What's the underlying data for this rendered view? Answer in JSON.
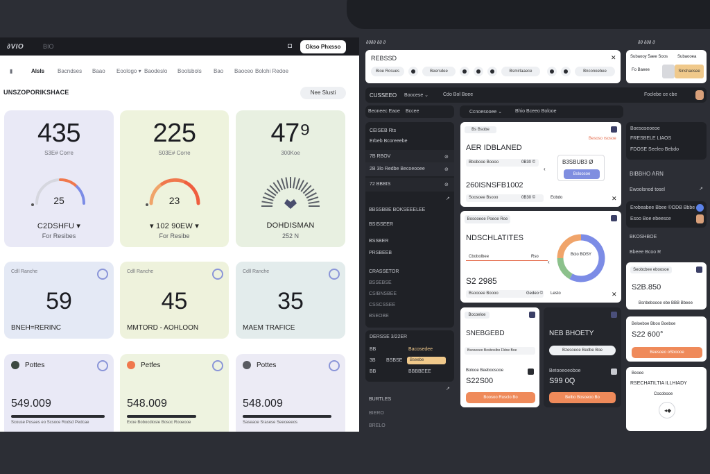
{
  "colors": {
    "accent_blue": "#7f8ee0",
    "accent_orange": "#ef8a5a",
    "gauge_red": "#f0784d",
    "gauge_blue": "#7c8ce6",
    "gauge_green": "#8cc18c",
    "dark_panel": "#1f2126",
    "backdrop": "#2c2e35"
  },
  "left": {
    "titlebar": {
      "brand": "∂VIO",
      "brand2": "BIO",
      "action_button": "Gkso Phxsso",
      "icon": "camera-icon"
    },
    "nav": [
      {
        "label": "Alsls",
        "active": true
      },
      {
        "label": "Bacndses"
      },
      {
        "label": "Baao"
      },
      {
        "label": "Eoologo ▾"
      },
      {
        "label": "Baodeslo"
      },
      {
        "label": "Boolsbols"
      },
      {
        "label": "Bao"
      },
      {
        "label": "Baoceo"
      },
      {
        "label": "Bolohi Redoe"
      }
    ],
    "section_title": "UNSZOPORIKSHACE",
    "section_button": "Nee Slusti",
    "stat_cards": [
      {
        "value": "435",
        "sub": "S3E# Corre",
        "gauge_value": "25",
        "foot1": "C2DSHFU ▾",
        "foot2": "For Resibes"
      },
      {
        "value": "225",
        "sub": "S03E# Corre",
        "gauge_value": "23",
        "foot1": "▾ 102 90EW ▾",
        "foot2": "For Resibe"
      },
      {
        "value": "47⁹",
        "sub": "300Koe",
        "gauge_value": "",
        "foot1": "DOHDISMAN",
        "foot2": "252 N"
      }
    ],
    "metric_cards": [
      {
        "label": "Cdll Ranche",
        "value": "59",
        "caption": "BNEH=RERINC"
      },
      {
        "label": "Cdll Ranche",
        "value": "45",
        "caption": "MMTORD - AOHLOON"
      },
      {
        "label": "Cdll Ranche",
        "value": "35",
        "caption": "MAEM TRAFICE"
      }
    ],
    "payment_cards": [
      {
        "label": "Pottes",
        "value": "549.009",
        "dot": "#3d4a42",
        "line": "#2a2c31",
        "foot": "Scouse Posaes eo Scsoce Rodsd Pedcae"
      },
      {
        "label": "Petfes",
        "value": "548.009",
        "dot": "#f0784d",
        "line": "#2a2c31",
        "foot": "Exoe Bobocdiosie Bosoc Rooeooe"
      },
      {
        "label": "Pottes",
        "value": "548.009",
        "dot": "#5a5c62",
        "line": "#2a2c31",
        "foot": "Saseaoe Srasese Seeceeeos"
      }
    ]
  },
  "right": {
    "header": {
      "brand": "∂∂∂∂ ∂∂ ∂",
      "right": "∂∂ ∂∂∂ ∂"
    },
    "filter_card": {
      "title": "REBSSD",
      "chips": [
        "Bioe Rosues",
        "Beersdee",
        "Bsmirlaaece",
        "Bnconoebee"
      ]
    },
    "mini_card": {
      "title": "Subaooy 5aee Soos",
      "title2": "Subaooea",
      "field": "Fo Baeee",
      "button": "Sinshaosee"
    },
    "search_bar": {
      "title": "CUSSEEO",
      "a": "Boocese ⌄",
      "b": "Cdo Bol Boee"
    },
    "sub_bar": {
      "a": "Beoneec Eaoe",
      "b": "Bccee",
      "c": "Ccnoesooee ⌄",
      "d": "Bhio Bceeo Bolooe"
    },
    "user": {
      "label": "Foclebe ce cbe"
    },
    "sidebar": {
      "group1": [
        "CEISEB Rts",
        "Erbeb Bcoreeebe"
      ],
      "rows": [
        {
          "label": "7B RBOV",
          "icon": "⊘"
        },
        {
          "label": "2B 3lo Redbe Becoeooee",
          "icon": "⊘"
        },
        {
          "label": "72 BBBIS",
          "icon": "⊘"
        }
      ],
      "group2": [
        "BBSSBBE BOKSEEELEE",
        "BSISSEER",
        "BSSBER",
        "PRSBEEB",
        "CRASSETOR",
        "BSSEBSE",
        "CSIBNSBEE",
        "CSSCSSEE",
        "BSEOBE"
      ],
      "group3_title": "DERSSE 3/22ER",
      "group3": [
        {
          "a": "BB",
          "b": "Bacosedee"
        },
        {
          "a": "3B",
          "b": "Bseebe",
          "highlight": true
        },
        {
          "a": "BB",
          "b": "BBBBEEE"
        }
      ],
      "group4": [
        "BURTLES",
        "BIERO",
        "BRELO"
      ]
    },
    "detail_card_1": {
      "tag": "Bs Bsobe",
      "title": "AER IDBLANED",
      "badge": "Besoso rsosoe",
      "field1": "Bbobooe Boooo",
      "field1v": "0B30 ©",
      "subtitle": "260ISNSFB1002",
      "field2": "Soosoee Bsooo",
      "field2v": "0B30 ©",
      "label2": "Eobdo",
      "price": "B3SBUB3 Ø",
      "blue_btn": "Bsloosoe"
    },
    "detail_card_2": {
      "tag": "Bosooeoe Poeoe Roe",
      "title": "NDSCHLATITES",
      "field1": "Cbobolbee",
      "field1v": "Rso",
      "amount": "S2 2985",
      "field2": "Bsoooee Boooo",
      "field2v": "Gedeo ©",
      "label2": "Lesto",
      "donut_label": "Bcio BOSY",
      "donut": [
        {
          "label": "blue",
          "value": 58,
          "color": "#7c8ce6"
        },
        {
          "label": "green",
          "value": 17,
          "color": "#8cc18c"
        },
        {
          "label": "orange",
          "value": 25,
          "color": "#f0a46a"
        }
      ]
    },
    "side_card_1": {
      "label": "Boesoseoeoe",
      "title": "FRESBELE LIAOS",
      "sub": "FDOSE Seeleo Bebdo",
      "label2": "Seobcbee eboosoe",
      "amount": "S2B.850",
      "row2": "Bsnbeboooe ebe BBB Bbeee"
    },
    "side_card_2": {
      "label": "Beloeboe Bboo Boeboe",
      "amount": "S22 600°",
      "button": "Beesoeo oSboooe"
    },
    "side_card_3": {
      "label": "Beoee",
      "title": "RSECHATILTIA ILLHIADY",
      "sub": "Cocobooe"
    },
    "bottom_card_1": {
      "tag": "Bocoeloe",
      "title": "SNEBGEBD",
      "sub": "Bsooeoeo Bosboslbo Fldoe Boe",
      "label": "Bolooe Beeboosooe",
      "amount": "S22S00",
      "button": "Boosoo Rusclo Bo"
    },
    "bottom_card_2": {
      "title": "NEB BHOETY",
      "chip": "Bzesoeoe Bedbe Boe",
      "label": "Betooeoeoboe",
      "amount": "S99 0Q",
      "button": "Belbo Bosoeoo Bo"
    },
    "dark_mini": {
      "title": "BIBBHO ARN",
      "line": "Ewoolsnod tosel",
      "row1": "Erobeabee Bbee ©ODB Bbbe",
      "row2": "Esoo Boe ebeesce",
      "row3": "BKOSHBOE",
      "row4": "Bbeee Bcoo R"
    }
  }
}
